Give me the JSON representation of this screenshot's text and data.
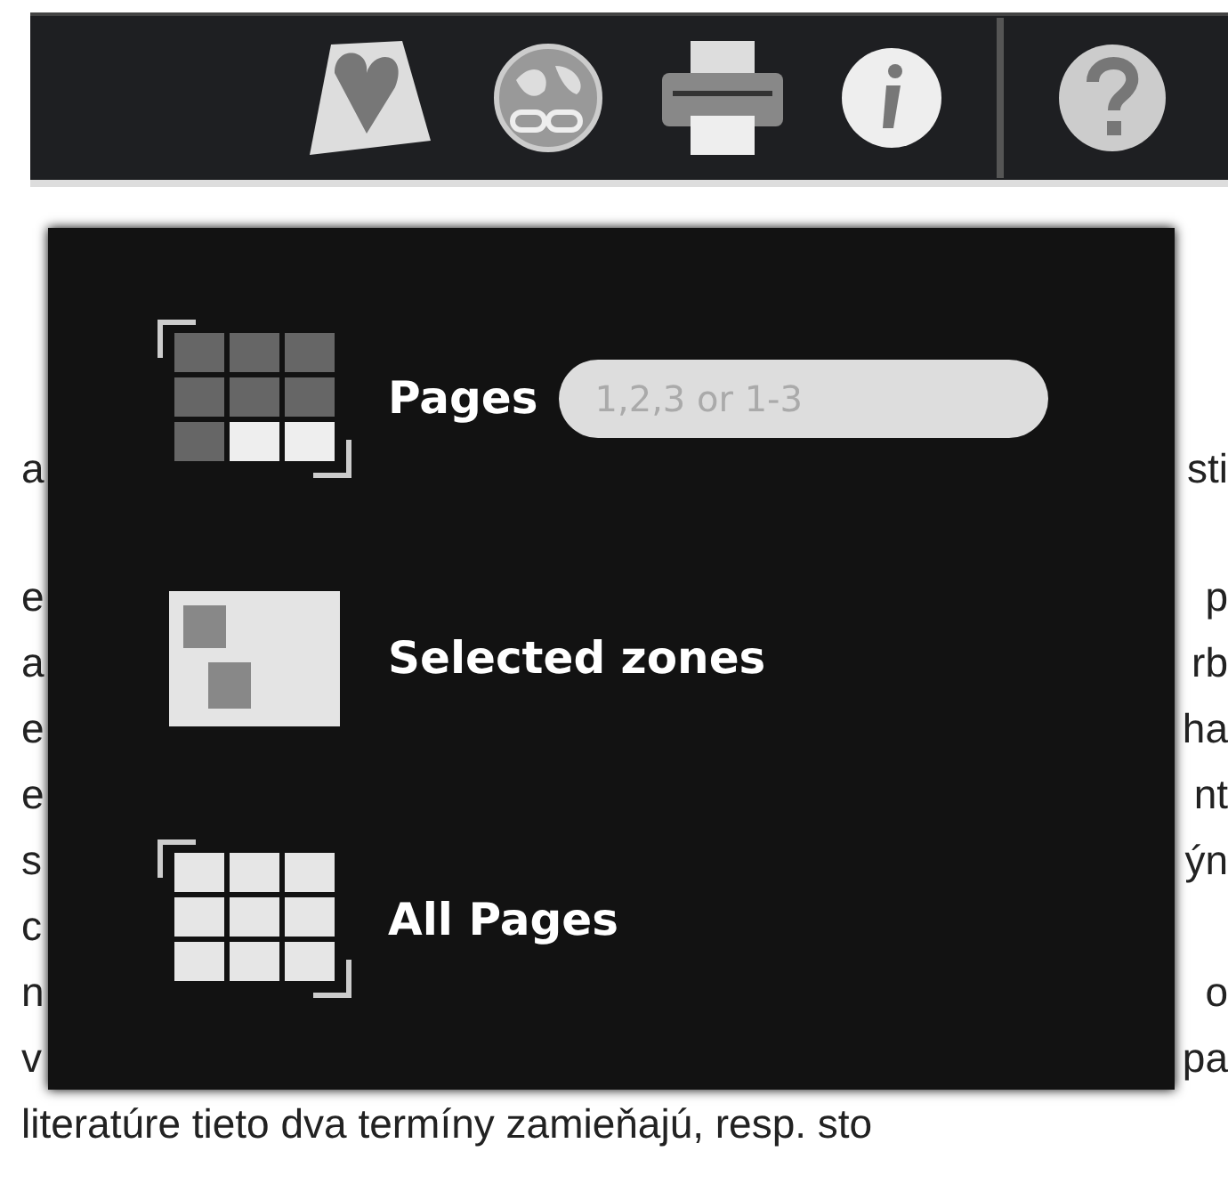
{
  "document": {
    "lines": [
      {
        "left": "a",
        "right": "sti"
      },
      {
        "left": "e",
        "right": "p"
      },
      {
        "left": "a",
        "right": "rb"
      },
      {
        "left": "e",
        "right": "ha"
      },
      {
        "left": "e",
        "right": "nt"
      },
      {
        "left": "s",
        "right": "ýn"
      },
      {
        "left": "c"
      },
      {
        "left": "n",
        "right": "o"
      },
      {
        "left": "v",
        "right": "pa"
      },
      {
        "left": "literatúre tieto dva termíny zamieňajú, resp. sto"
      }
    ]
  },
  "print_menu": {
    "options": [
      {
        "kind": "pages",
        "label": "Pages",
        "placeholder": "1,2,3 or 1-3"
      },
      {
        "kind": "zones",
        "label": "Selected zones"
      },
      {
        "kind": "all",
        "label": "All Pages"
      }
    ]
  }
}
